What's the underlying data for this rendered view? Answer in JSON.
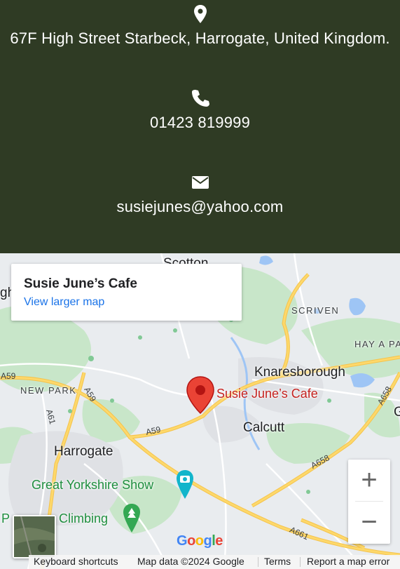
{
  "contact": {
    "address": "67F High Street Starbeck, Harrogate, United Kingdom.",
    "phone": "01423 819999",
    "email": "susiejunes@yahoo.com",
    "icons": [
      "map-marker-icon",
      "phone-icon",
      "envelope-icon"
    ]
  },
  "map": {
    "card_title": "Susie June’s Cafe",
    "card_link": "View larger map",
    "pin_label": "Susie June’s Cafe",
    "labels": {
      "scotton": "Scotton",
      "scriven": "SCRIVEN",
      "hay_a_pa": "HAY A PA",
      "knaresborough": "Knaresborough",
      "new_park": "NEW PARK",
      "calcutt": "Calcutt",
      "harrogate": "Harrogate",
      "great_yorkshire_show": "Great Yorkshire Show",
      "climbing": "Climbing",
      "edge_gh": "gh",
      "edge_p": "P",
      "edge_g": "G"
    },
    "roads": {
      "a59_left": "A59",
      "a59_mid": "A59",
      "a59_center": "A59",
      "a61": "A61",
      "a658_top": "A658",
      "a658_bottom": "A658",
      "a661": "A661"
    },
    "zoom_in": "+",
    "zoom_out": "−",
    "google_logo": "Google",
    "footer": {
      "keyboard_shortcuts": "Keyboard shortcuts",
      "map_data": "Map data ©2024 Google",
      "terms": "Terms",
      "report": "Report a map error"
    }
  },
  "colors": {
    "header_bg": "#2f3b24",
    "pin_red": "#ea4335",
    "road_yellow": "#fdd86b",
    "park_green": "#bfe3c1",
    "water_blue": "#9ec5f5",
    "link_blue": "#1a73e8"
  }
}
